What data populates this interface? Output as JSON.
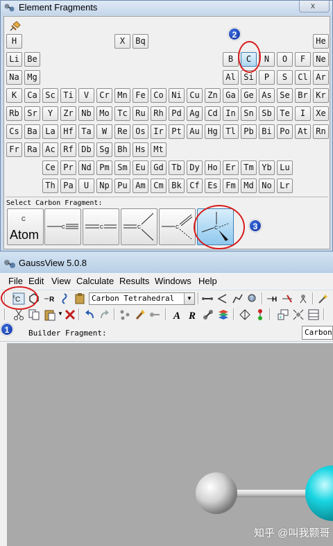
{
  "element_fragments": {
    "title": "Element Fragments",
    "close_label": "x",
    "periodic_rows": [
      [
        {
          "s": "H"
        },
        {
          "s": "X"
        },
        {
          "s": "Bq"
        },
        {
          "s": "He"
        }
      ],
      [
        {
          "s": "Li"
        },
        {
          "s": "Be"
        },
        {
          "s": "B"
        },
        {
          "s": "C",
          "selected": true
        },
        {
          "s": "N"
        },
        {
          "s": "O"
        },
        {
          "s": "F"
        },
        {
          "s": "Ne"
        }
      ],
      [
        {
          "s": "Na"
        },
        {
          "s": "Mg"
        },
        {
          "s": "Al"
        },
        {
          "s": "Si"
        },
        {
          "s": "P"
        },
        {
          "s": "S"
        },
        {
          "s": "Cl"
        },
        {
          "s": "Ar"
        }
      ],
      [
        {
          "s": "K"
        },
        {
          "s": "Ca"
        },
        {
          "s": "Sc"
        },
        {
          "s": "Ti"
        },
        {
          "s": "V"
        },
        {
          "s": "Cr"
        },
        {
          "s": "Mn"
        },
        {
          "s": "Fe"
        },
        {
          "s": "Co"
        },
        {
          "s": "Ni"
        },
        {
          "s": "Cu"
        },
        {
          "s": "Zn"
        },
        {
          "s": "Ga"
        },
        {
          "s": "Ge"
        },
        {
          "s": "As"
        },
        {
          "s": "Se"
        },
        {
          "s": "Br"
        },
        {
          "s": "Kr"
        }
      ],
      [
        {
          "s": "Rb"
        },
        {
          "s": "Sr"
        },
        {
          "s": "Y"
        },
        {
          "s": "Zr"
        },
        {
          "s": "Nb"
        },
        {
          "s": "Mo"
        },
        {
          "s": "Tc"
        },
        {
          "s": "Ru"
        },
        {
          "s": "Rh"
        },
        {
          "s": "Pd"
        },
        {
          "s": "Ag"
        },
        {
          "s": "Cd"
        },
        {
          "s": "In"
        },
        {
          "s": "Sn"
        },
        {
          "s": "Sb"
        },
        {
          "s": "Te"
        },
        {
          "s": "I"
        },
        {
          "s": "Xe"
        }
      ],
      [
        {
          "s": "Cs"
        },
        {
          "s": "Ba"
        },
        {
          "s": "La"
        },
        {
          "s": "Hf"
        },
        {
          "s": "Ta"
        },
        {
          "s": "W"
        },
        {
          "s": "Re"
        },
        {
          "s": "Os"
        },
        {
          "s": "Ir"
        },
        {
          "s": "Pt"
        },
        {
          "s": "Au"
        },
        {
          "s": "Hg"
        },
        {
          "s": "Tl"
        },
        {
          "s": "Pb"
        },
        {
          "s": "Bi"
        },
        {
          "s": "Po"
        },
        {
          "s": "At"
        },
        {
          "s": "Rn"
        }
      ],
      [
        {
          "s": "Fr"
        },
        {
          "s": "Ra"
        },
        {
          "s": "Ac"
        },
        {
          "s": "Rf"
        },
        {
          "s": "Db"
        },
        {
          "s": "Sg"
        },
        {
          "s": "Bh"
        },
        {
          "s": "Hs"
        },
        {
          "s": "Mt"
        }
      ],
      [
        {
          "s": "Ce"
        },
        {
          "s": "Pr"
        },
        {
          "s": "Nd"
        },
        {
          "s": "Pm"
        },
        {
          "s": "Sm"
        },
        {
          "s": "Eu"
        },
        {
          "s": "Gd"
        },
        {
          "s": "Tb"
        },
        {
          "s": "Dy"
        },
        {
          "s": "Ho"
        },
        {
          "s": "Er"
        },
        {
          "s": "Tm"
        },
        {
          "s": "Yb"
        },
        {
          "s": "Lu"
        }
      ],
      [
        {
          "s": "Th"
        },
        {
          "s": "Pa"
        },
        {
          "s": "U"
        },
        {
          "s": "Np"
        },
        {
          "s": "Pu"
        },
        {
          "s": "Am"
        },
        {
          "s": "Cm"
        },
        {
          "s": "Bk"
        },
        {
          "s": "Cf"
        },
        {
          "s": "Es"
        },
        {
          "s": "Fm"
        },
        {
          "s": "Md"
        },
        {
          "s": "No"
        },
        {
          "s": "Lr"
        }
      ]
    ],
    "select_label": "Select Carbon Fragment:",
    "fragments": [
      {
        "name": "atom",
        "small": "C",
        "big": "Atom"
      },
      {
        "name": "triple-bond",
        "symbol": "C"
      },
      {
        "name": "double-bond",
        "symbol": "C"
      },
      {
        "name": "trigonal",
        "symbol": "C"
      },
      {
        "name": "bent",
        "symbol": "C"
      },
      {
        "name": "tetrahedral",
        "symbol": "C",
        "selected": true
      }
    ],
    "annotations": {
      "step2": "2",
      "step3": "3"
    }
  },
  "gaussview": {
    "title": "GaussView 5.0.8",
    "menu": [
      "File",
      "Edit",
      "View",
      "Calculate",
      "Results",
      "Windows",
      "Help"
    ],
    "fragment_select_value": "Carbon Tetrahedral",
    "builder_label": "Builder Fragment:",
    "builder_value": "Carbon",
    "annotation_step1": "1",
    "accent_color": "#00c8d2",
    "highlight_color": "#d81b1b"
  },
  "watermark": "知乎 @叫我颢哥"
}
